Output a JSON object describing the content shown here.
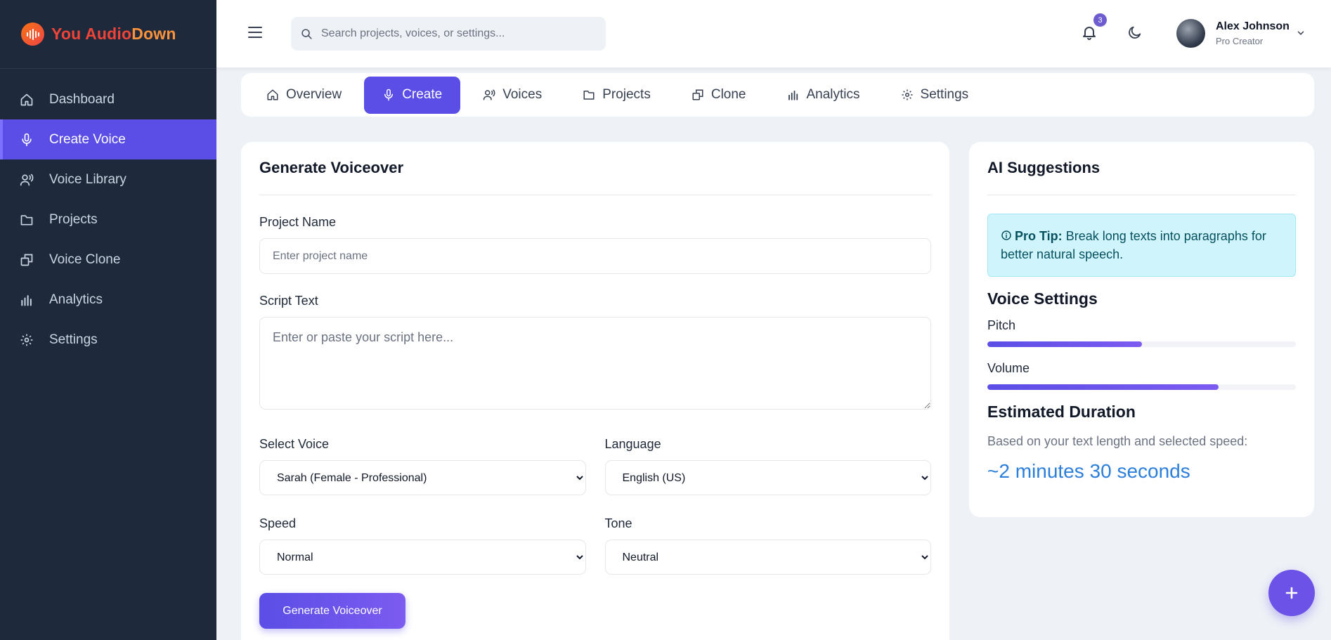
{
  "brand": {
    "part1": "You Audio",
    "part2": "Down"
  },
  "sidebar": {
    "items": [
      {
        "label": "Dashboard",
        "icon": "home-icon"
      },
      {
        "label": "Create Voice",
        "icon": "microphone-icon",
        "active": true
      },
      {
        "label": "Voice Library",
        "icon": "voice-icon"
      },
      {
        "label": "Projects",
        "icon": "folder-icon"
      },
      {
        "label": "Voice Clone",
        "icon": "clone-icon"
      },
      {
        "label": "Analytics",
        "icon": "bar-chart-icon"
      },
      {
        "label": "Settings",
        "icon": "gear-icon"
      }
    ]
  },
  "header": {
    "search_placeholder": "Search projects, voices, or settings...",
    "notification_count": "3",
    "user": {
      "name": "Alex Johnson",
      "role": "Pro Creator"
    }
  },
  "tabs": [
    {
      "label": "Overview",
      "icon": "home-icon"
    },
    {
      "label": "Create",
      "icon": "microphone-icon",
      "active": true
    },
    {
      "label": "Voices",
      "icon": "voice-icon"
    },
    {
      "label": "Projects",
      "icon": "folder-icon"
    },
    {
      "label": "Clone",
      "icon": "clone-icon"
    },
    {
      "label": "Analytics",
      "icon": "bar-chart-icon"
    },
    {
      "label": "Settings",
      "icon": "gear-icon"
    }
  ],
  "generate": {
    "title": "Generate Voiceover",
    "project_name_label": "Project Name",
    "project_name_placeholder": "Enter project name",
    "script_label": "Script Text",
    "script_placeholder": "Enter or paste your script here...",
    "voice_label": "Select Voice",
    "voice_value": "Sarah (Female - Professional)",
    "language_label": "Language",
    "language_value": "English (US)",
    "speed_label": "Speed",
    "speed_value": "Normal",
    "tone_label": "Tone",
    "tone_value": "Neutral",
    "button_label": "Generate Voiceover"
  },
  "ai": {
    "title": "AI Suggestions",
    "tip_prefix": "Pro Tip:",
    "tip_text": "Break long texts into paragraphs for better natural speech.",
    "voice_settings_title": "Voice Settings",
    "pitch_label": "Pitch",
    "pitch_percent": 50,
    "volume_label": "Volume",
    "volume_percent": 75,
    "duration_title": "Estimated Duration",
    "duration_desc": "Based on your text length and selected speed:",
    "duration_value": "~2 minutes 30 seconds"
  },
  "colors": {
    "accent": "#5b4ee6",
    "sidebar_bg": "#1e293b",
    "duration": "#2b7fdb",
    "tip_bg": "#cff4fb"
  }
}
